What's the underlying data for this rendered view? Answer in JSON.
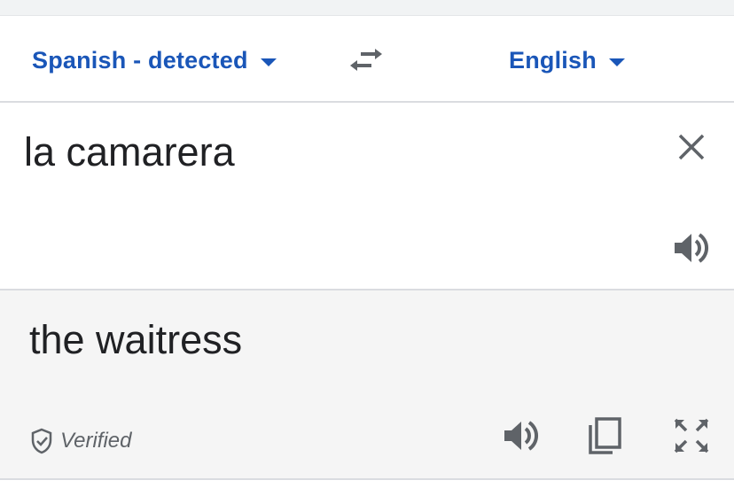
{
  "languages": {
    "source_label": "Spanish - detected",
    "target_label": "English"
  },
  "source": {
    "text": "la camarera"
  },
  "result": {
    "text": "the waitress",
    "verified_label": "Verified"
  },
  "icons": {
    "source_caret": "caret-down-icon",
    "target_caret": "caret-down-icon",
    "swap": "swap-languages-icon",
    "clear": "close-icon",
    "source_speaker": "speaker-icon",
    "result_speaker": "speaker-icon",
    "copy": "copy-icon",
    "expand": "fullscreen-icon",
    "verified": "shield-check-icon"
  },
  "colors": {
    "accent": "#1a56b8",
    "text": "#202124",
    "icon": "#5f6368",
    "result_background": "#f5f5f5",
    "divider": "#dadce0"
  }
}
